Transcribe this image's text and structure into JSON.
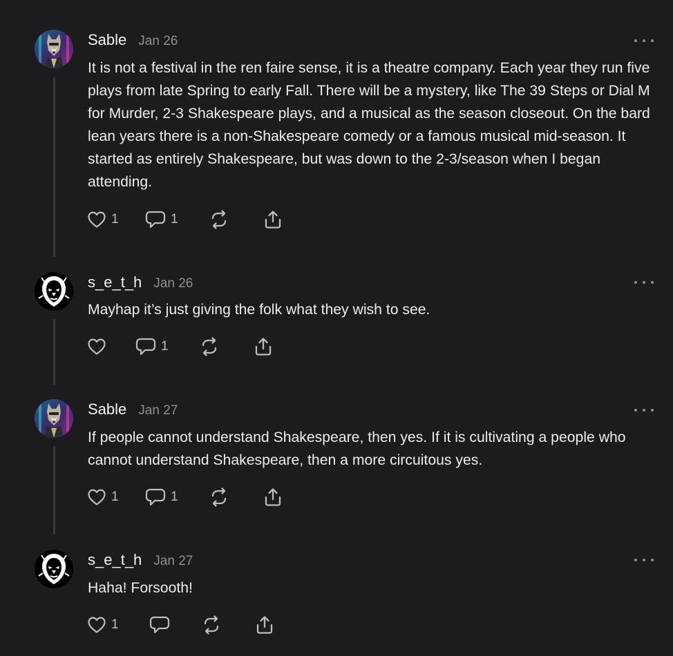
{
  "comments": [
    {
      "username": "Sable",
      "date": "Jan 26",
      "avatar_icon": "fox-avatar-icon",
      "text": "It is not a festival in the ren faire sense, it is a theatre company. Each year they run five plays from late Spring to early Fall. There will be a mystery, like The 39 Steps or Dial M for Murder, 2-3 Shakespeare plays, and a musical as the season closeout. On the bard lean years there is a non-Shakespeare comedy or a famous musical mid-season. It started as entirely Shakespeare, but was down to the 2-3/season when I began attending.",
      "likes": "1",
      "replies": "1"
    },
    {
      "username": "s_e_t_h",
      "date": "Jan 26",
      "avatar_icon": "lion-avatar-icon",
      "text": "Mayhap it’s just giving the folk what they wish to see.",
      "likes": "",
      "replies": "1"
    },
    {
      "username": "Sable",
      "date": "Jan 27",
      "avatar_icon": "fox-avatar-icon",
      "text": "If people cannot understand Shakespeare, then yes. If it is cultivating a people who cannot understand Shakespeare, then a more circuitous yes.",
      "likes": "1",
      "replies": "1"
    },
    {
      "username": "s_e_t_h",
      "date": "Jan 27",
      "avatar_icon": "lion-avatar-icon",
      "text": "Haha! Forsooth!",
      "likes": "1",
      "replies": ""
    }
  ],
  "icons": {
    "like": "heart-icon",
    "reply": "comment-bubble-icon",
    "restack": "restack-icon",
    "share": "share-icon",
    "more": "more-dots-icon"
  },
  "colors": {
    "background": "#1c1c1e",
    "text": "#ededed",
    "muted": "#8e8e93",
    "thread_line": "#3a3a3c"
  }
}
